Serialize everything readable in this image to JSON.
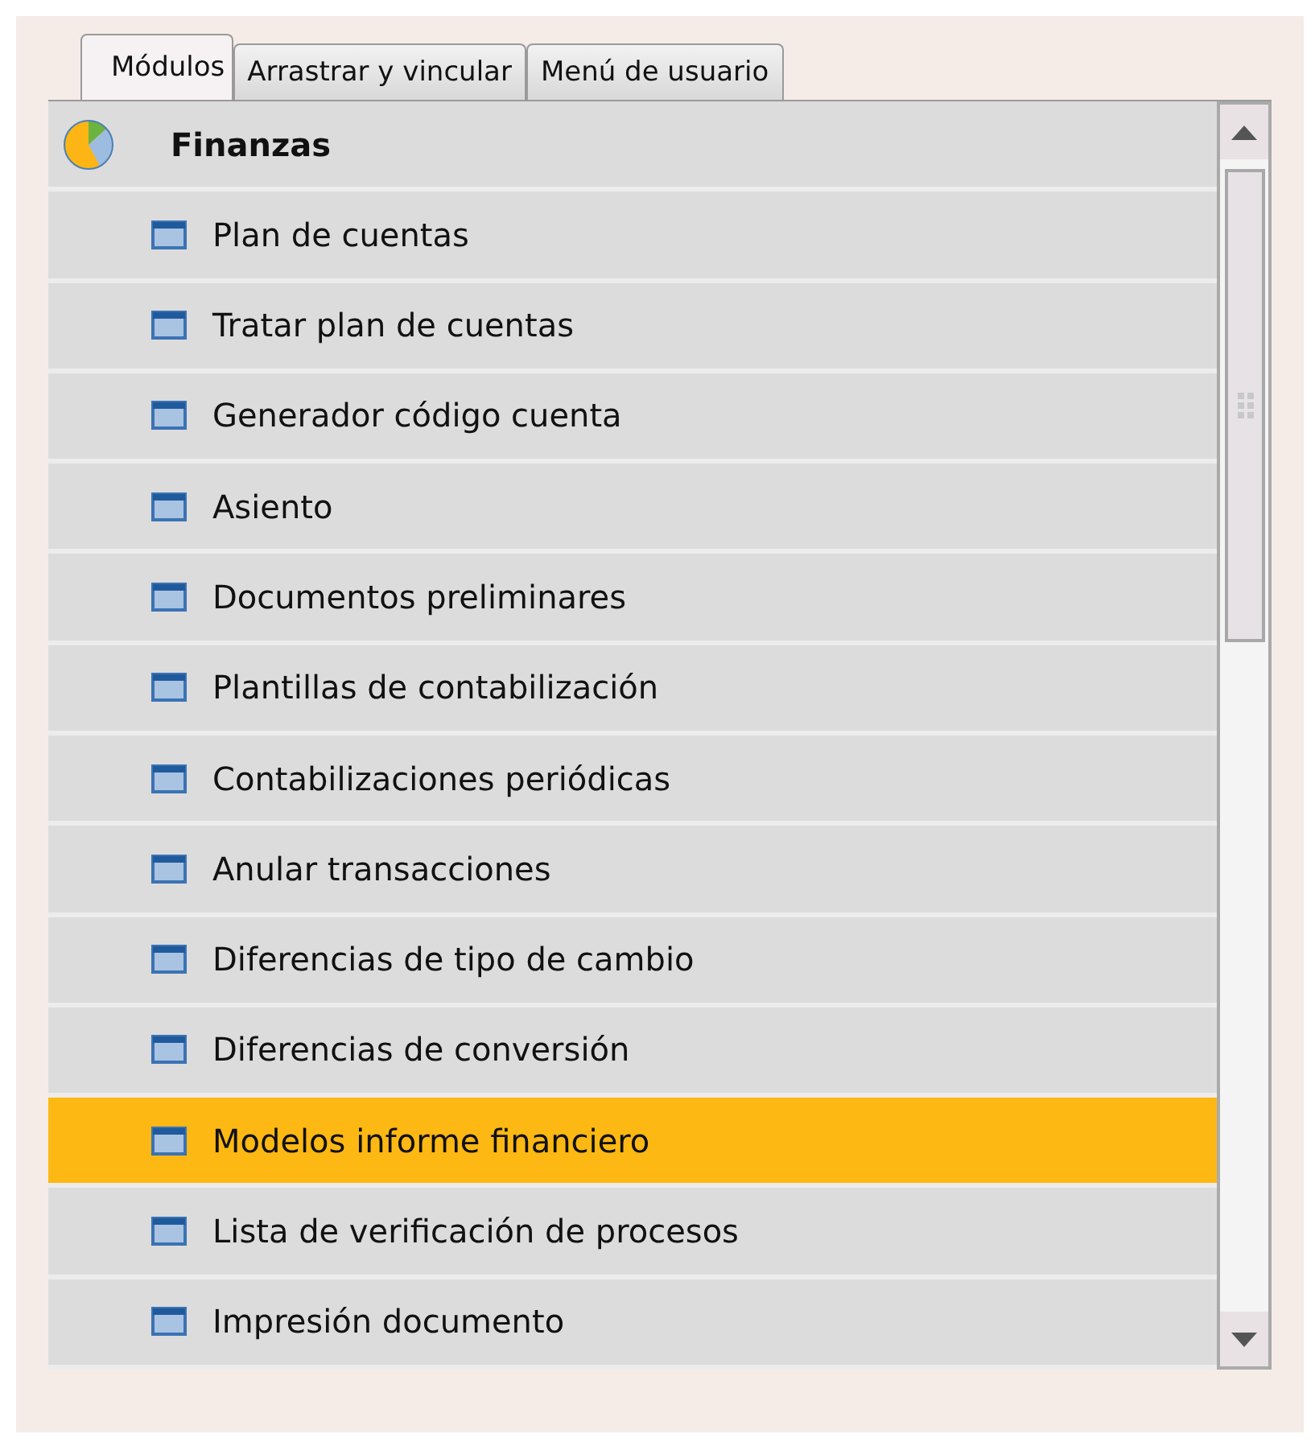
{
  "tabs": [
    {
      "label": "Módulos",
      "selected": true
    },
    {
      "label": "Arrastrar y vincular",
      "selected": false
    },
    {
      "label": "Menú de usuario",
      "selected": false
    }
  ],
  "module": {
    "title": "Finanzas"
  },
  "items": [
    {
      "label": "Plan de cuentas",
      "selected": false
    },
    {
      "label": "Tratar plan de cuentas",
      "selected": false
    },
    {
      "label": "Generador código cuenta",
      "selected": false
    },
    {
      "label": "Asiento",
      "selected": false
    },
    {
      "label": "Documentos preliminares",
      "selected": false
    },
    {
      "label": "Plantillas de contabilización",
      "selected": false
    },
    {
      "label": "Contabilizaciones periódicas",
      "selected": false
    },
    {
      "label": "Anular transacciones",
      "selected": false
    },
    {
      "label": "Diferencias de tipo de cambio",
      "selected": false
    },
    {
      "label": "Diferencias de conversión",
      "selected": false
    },
    {
      "label": "Modelos informe financiero",
      "selected": true
    },
    {
      "label": "Lista de verificación de procesos",
      "selected": false
    },
    {
      "label": "Impresión documento",
      "selected": false
    }
  ]
}
